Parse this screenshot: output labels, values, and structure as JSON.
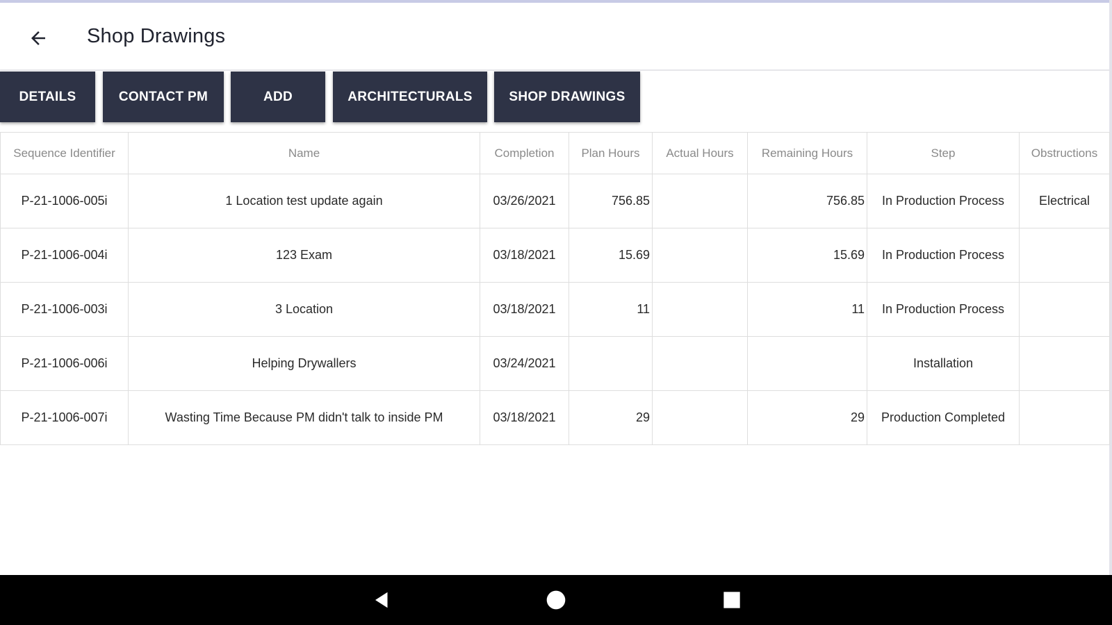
{
  "header": {
    "title": "Shop Drawings",
    "back_icon": "arrow-left-icon"
  },
  "toolbar": {
    "buttons": [
      {
        "label": "DETAILS"
      },
      {
        "label": "CONTACT PM"
      },
      {
        "label": "ADD"
      },
      {
        "label": "ARCHITECTURALS"
      },
      {
        "label": "SHOP DRAWINGS"
      }
    ]
  },
  "table": {
    "columns": [
      "Sequence Identifier",
      "Name",
      "Completion",
      "Plan Hours",
      "Actual Hours",
      "Remaining Hours",
      "Step",
      "Obstructions"
    ],
    "rows": [
      {
        "id": "P-21-1006-005i",
        "name": "1 Location test update again",
        "completion": "03/26/2021",
        "plan": "756.85",
        "actual": "",
        "remaining": "756.85",
        "step": "In Production Process",
        "obstructions": "Electrical"
      },
      {
        "id": "P-21-1006-004i",
        "name": "123 Exam",
        "completion": "03/18/2021",
        "plan": "15.69",
        "actual": "",
        "remaining": "15.69",
        "step": "In Production Process",
        "obstructions": ""
      },
      {
        "id": "P-21-1006-003i",
        "name": "3 Location",
        "completion": "03/18/2021",
        "plan": "11",
        "actual": "",
        "remaining": "11",
        "step": "In Production Process",
        "obstructions": ""
      },
      {
        "id": "P-21-1006-006i",
        "name": "Helping Drywallers",
        "completion": "03/24/2021",
        "plan": "",
        "actual": "",
        "remaining": "",
        "step": "Installation",
        "obstructions": ""
      },
      {
        "id": "P-21-1006-007i",
        "name": "Wasting Time Because PM didn't talk to inside PM",
        "completion": "03/18/2021",
        "plan": "29",
        "actual": "",
        "remaining": "29",
        "step": "Production Completed",
        "obstructions": ""
      }
    ]
  },
  "nav": {
    "back_icon": "triangle-back-icon",
    "home_icon": "circle-home-icon",
    "recents_icon": "square-recents-icon"
  },
  "colors": {
    "button_bg": "#2e3346",
    "nav_bg": "#000000",
    "accent_top": "#c8cbe6"
  }
}
